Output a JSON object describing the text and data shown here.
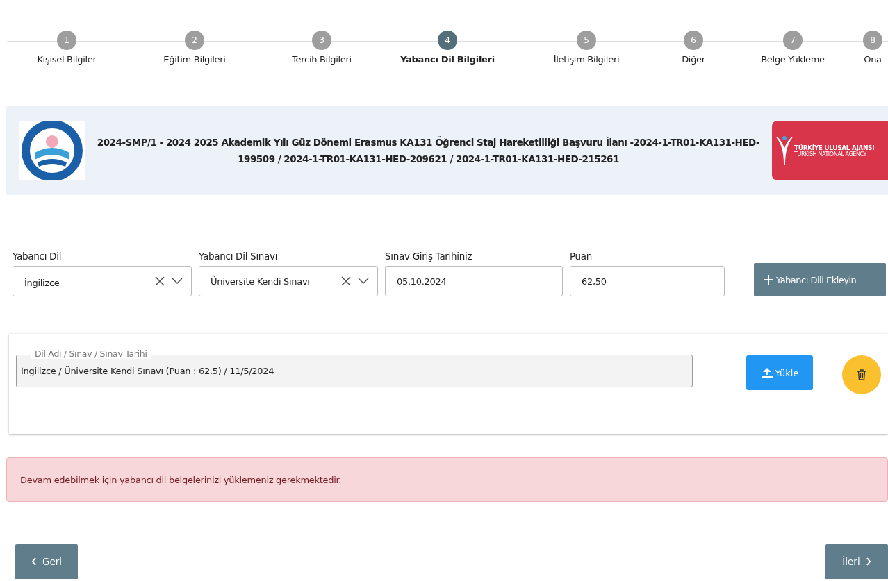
{
  "steps": [
    {
      "number": "1",
      "label": "Kişisel Bilgiler",
      "selected": false
    },
    {
      "number": "2",
      "label": "Eğitim Bilgileri",
      "selected": false
    },
    {
      "number": "3",
      "label": "Tercih Bilgileri",
      "selected": false
    },
    {
      "number": "4",
      "label": "Yabancı Dil Bilgileri",
      "selected": true
    },
    {
      "number": "5",
      "label": "İletişim Bilgileri",
      "selected": false
    },
    {
      "number": "6",
      "label": "Diğer",
      "selected": false
    },
    {
      "number": "7",
      "label": "Belge Yükleme",
      "selected": false
    },
    {
      "number": "8",
      "label": "Ona",
      "selected": false
    }
  ],
  "banner": {
    "title": "2024-SMP/1 - 2024 2025 Akademik Yılı Güz Dönemi Erasmus KA131 Öğrenci Staj Hareketliliği Başvuru İlanı -2024-1-TR01-KA131-HED-199509 / 2024-1-TR01-KA131-HED-209621 / 2024-1-TR01-KA131-HED-215261",
    "agency_logo": {
      "line_1": "TÜRKİYE ULUSAL AJANSI",
      "line_2": "TURKISH NATIONAL AGENCY"
    }
  },
  "form": {
    "fields": [
      {
        "kind": "select",
        "label": "Yabancı Dil",
        "value": "İngilizce"
      },
      {
        "kind": "select",
        "label": "Yabancı Dil Sınavı",
        "value": "Üniversite Kendi Sınavı"
      },
      {
        "kind": "text",
        "label": "Sınav Giriş Tarihiniz",
        "value": "05.10.2024"
      },
      {
        "kind": "text",
        "label": "Puan",
        "value": "62,50"
      }
    ],
    "add_button": "Yabancı Dili Ekleyin"
  },
  "entries": [
    {
      "legend": "Dil Adı / Sınav / Sınav Tarihi",
      "value": "İngilizce / Üniversite Kendi Sınavı (Puan : 62.5) / 11/5/2024",
      "upload_button": "Yükle"
    }
  ],
  "alert": "Devam edebilmek için yabancı dil belgelerinizi yüklemeniz gerekmektedir.",
  "nav": {
    "back": "Geri",
    "next": "İleri"
  }
}
